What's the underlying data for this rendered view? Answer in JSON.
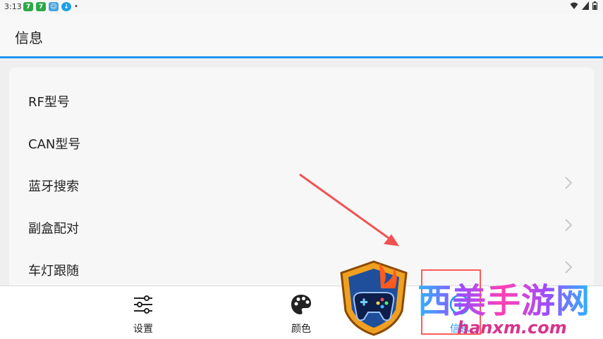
{
  "status_bar": {
    "time": "3:13",
    "app_icons": [
      "green-app-icon",
      "green-app-icon",
      "blue-chat-icon",
      "blue-download-icon"
    ],
    "dot": "•"
  },
  "app_bar": {
    "title": "信息"
  },
  "info_list": {
    "items": [
      {
        "label": "RF型号",
        "has_chevron": false
      },
      {
        "label": "CAN型号",
        "has_chevron": false
      },
      {
        "label": "蓝牙搜索",
        "has_chevron": true
      },
      {
        "label": "副盒配对",
        "has_chevron": true
      },
      {
        "label": "车灯跟随",
        "has_chevron": true
      }
    ]
  },
  "bottom_nav": {
    "items": [
      {
        "label": "设置",
        "icon": "sliders-icon",
        "active": false
      },
      {
        "label": "颜色",
        "icon": "palette-icon",
        "active": false
      },
      {
        "label": "信息",
        "icon": "info-icon",
        "active": true
      }
    ]
  },
  "watermark": {
    "brand": "西美手游网",
    "url": "www.hanxm.com",
    "visible_url": "hanxm.com"
  },
  "colors": {
    "accent": "#2196f3",
    "annotation_red": "#ff5a5a"
  }
}
